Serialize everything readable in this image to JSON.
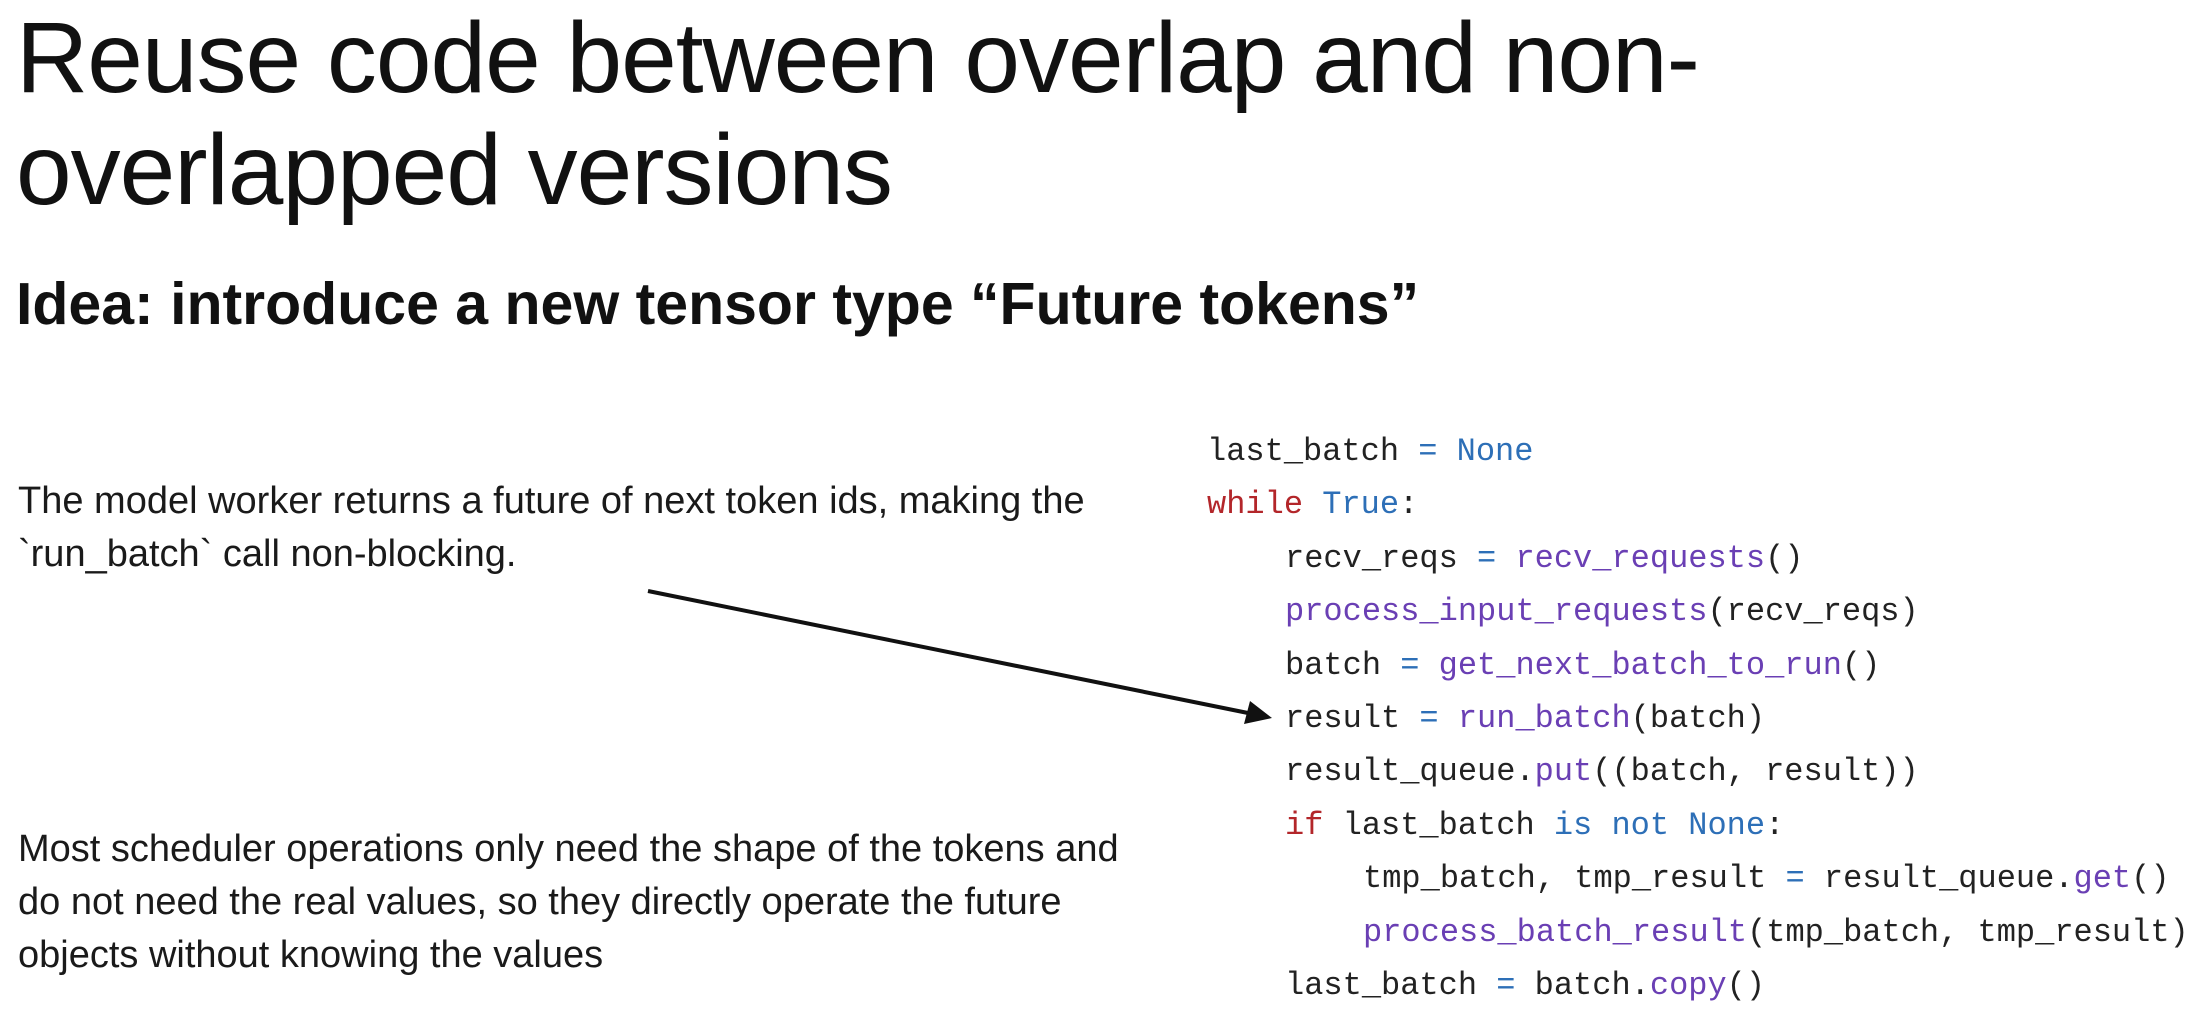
{
  "slide": {
    "title": "Reuse code between overlap and non-overlapped versions",
    "subtitle": "Idea: introduce a new tensor type “Future tokens”",
    "paragraph1": "The model worker returns a future of next token ids, making the `run_batch` call non-blocking.",
    "paragraph2": "Most scheduler operations only need the shape of the tokens and do not need the real values, so they directly operate the future objects without knowing the values"
  },
  "code": {
    "line1": {
      "var": "last_batch",
      "eq": " = ",
      "val": "None"
    },
    "line2": {
      "kw": "while",
      "sp": " ",
      "val": "True",
      "colon": ":"
    },
    "line3": {
      "var": "recv_reqs",
      "eq": " = ",
      "fn": "recv_requests",
      "rest": "()"
    },
    "line4": {
      "fn": "process_input_requests",
      "rest": "(recv_reqs)"
    },
    "line5": {
      "var": "batch",
      "eq": " = ",
      "fn": "get_next_batch_to_run",
      "rest": "()"
    },
    "line6": {
      "var": "result",
      "eq": " = ",
      "fn": "run_batch",
      "rest": "(batch)"
    },
    "line7": {
      "var": "result_queue.",
      "fn": "put",
      "rest": "((batch, result))"
    },
    "line8": {
      "kw": "if",
      "mid": " last_batch ",
      "kw2": "is not",
      "sp": " ",
      "val": "None",
      "colon": ":"
    },
    "line9": {
      "var": "tmp_batch, tmp_result",
      "eq": " = ",
      "obj": "result_queue.",
      "fn": "get",
      "rest": "()"
    },
    "line10": {
      "fn": "process_batch_result",
      "rest": "(tmp_batch, tmp_result)"
    },
    "line11": {
      "var": "last_batch",
      "eq": " = ",
      "obj": "batch.",
      "fn": "copy",
      "rest": "()"
    }
  }
}
